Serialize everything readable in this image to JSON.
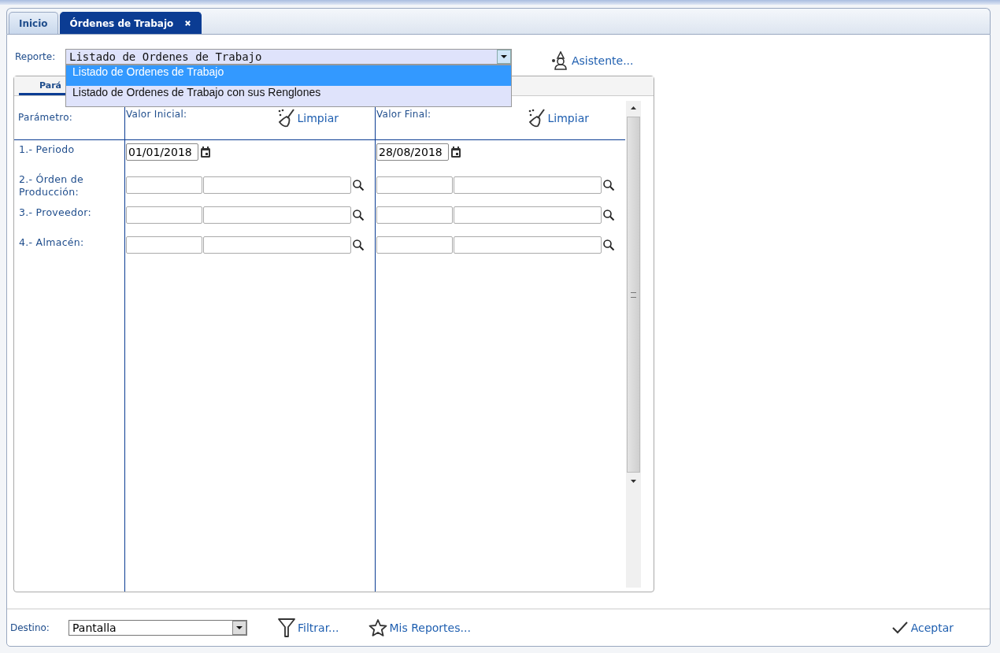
{
  "tabs": [
    {
      "label": "Inicio",
      "selected": false,
      "closable": false
    },
    {
      "label": "Órdenes de Trabajo",
      "selected": true,
      "closable": true
    }
  ],
  "report": {
    "label": "Reporte:",
    "value": "Listado de Ordenes de Trabajo",
    "expanded": true,
    "options": [
      {
        "label": "Listado de Ordenes de Trabajo",
        "selected": true
      },
      {
        "label": "Listado de Ordenes de Trabajo con sus Renglones",
        "selected": false
      }
    ]
  },
  "assistant_link": "Asistente...",
  "panel_tab": {
    "label": "Pará",
    "selected": true
  },
  "columns": {
    "parameter": "Parámetro:",
    "initial": {
      "title": "Valor Inicial:",
      "clear": "Limpiar"
    },
    "final": {
      "title": "Valor Final:",
      "clear": "Limpiar"
    }
  },
  "parameters": [
    {
      "label": "1.- Periodo",
      "kind": "date",
      "initial": "01/01/2018",
      "final": "28/08/2018"
    },
    {
      "label": "2.- Órden de Producción:",
      "kind": "lookup"
    },
    {
      "label": "3.- Proveedor:",
      "kind": "lookup"
    },
    {
      "label": "4.- Almacén:",
      "kind": "lookup"
    }
  ],
  "footer": {
    "destination": {
      "label": "Destino:",
      "value": "Pantalla"
    },
    "filter": "Filtrar...",
    "my_reports": "Mis Reportes...",
    "accept": "Aceptar"
  }
}
